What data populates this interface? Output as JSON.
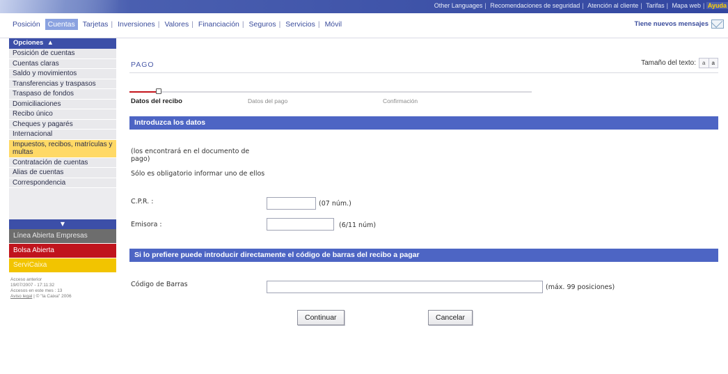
{
  "top_links": {
    "other_languages": "Other Languages",
    "security": "Recomendaciones de seguridad",
    "customer_service": "Atención al cliente",
    "rates": "Tarifas",
    "sitemap": "Mapa web",
    "help": "Ayuda"
  },
  "main_nav": {
    "tabs": [
      "Posición",
      "Cuentas",
      "Tarjetas",
      "Inversiones",
      "Valores",
      "Financiación",
      "Seguros",
      "Servicios",
      "Móvil"
    ],
    "active_tab": "Cuentas",
    "messages": "Tiene nuevos mensajes"
  },
  "sidebar": {
    "header": "Opciones",
    "items": [
      {
        "label": "Posición de cuentas",
        "highlighted": false
      },
      {
        "label": "Cuentas claras",
        "highlighted": false
      },
      {
        "label": "Saldo y movimientos",
        "highlighted": false
      },
      {
        "label": "Transferencias y traspasos",
        "highlighted": false
      },
      {
        "label": "Traspaso de fondos",
        "highlighted": false
      },
      {
        "label": "Domiciliaciones",
        "highlighted": false
      },
      {
        "label": "Recibo único",
        "highlighted": false
      },
      {
        "label": "Cheques y pagarés",
        "highlighted": false
      },
      {
        "label": "Internacional",
        "highlighted": false
      },
      {
        "label": "Impuestos, recibos, matrículas y multas",
        "highlighted": true
      },
      {
        "label": "Contratación de cuentas",
        "highlighted": false
      },
      {
        "label": "Alias de cuentas",
        "highlighted": false
      },
      {
        "label": "Correspondencia",
        "highlighted": false
      }
    ],
    "promos": [
      {
        "label": "Línea Abierta Empresas",
        "style": "gray"
      },
      {
        "label": "Bolsa Abierta",
        "style": "red"
      },
      {
        "label": "ServiCaixa",
        "style": "yellow"
      }
    ],
    "access": {
      "last_label": "Acceso anterior",
      "last_value": "19/07/2007 - 17:11:32",
      "month_label": "Accesos en este mes : 13",
      "legal": "Aviso legal",
      "copyright": "© \"la Caixa\" 2006"
    }
  },
  "content": {
    "title": "PAGO",
    "text_size_label": "Tamaño del texto:",
    "text_size_small": "a",
    "text_size_large": "a",
    "steps": [
      {
        "label": "Datos del recibo",
        "active": true
      },
      {
        "label": "Datos del pago",
        "active": false
      },
      {
        "label": "Confirmación",
        "active": false
      }
    ],
    "section1_title": "Introduzca los datos",
    "help1": "(los encontrará en el documento de pago)",
    "help2": "Sólo es obligatorio informar uno de ellos",
    "cpr_label": "C.P.R. :",
    "cpr_value": "",
    "cpr_hint": "(07 núm.)",
    "emisora_label": "Emisora :",
    "emisora_value": "",
    "emisora_hint": "(6/11 núm)",
    "section2_title": "Si lo prefiere puede introducir directamente el código de barras del recibo a pagar",
    "barcode_label": "Código de Barras",
    "barcode_value": "",
    "barcode_hint": "(máx. 99 posiciones)",
    "continue_label": "Continuar",
    "cancel_label": "Cancelar"
  },
  "colors": {
    "brand_blue": "#3c4fa8",
    "section_blue": "#4d65c4",
    "highlight_yellow": "#ffd966",
    "progress_red": "#c4141b"
  }
}
